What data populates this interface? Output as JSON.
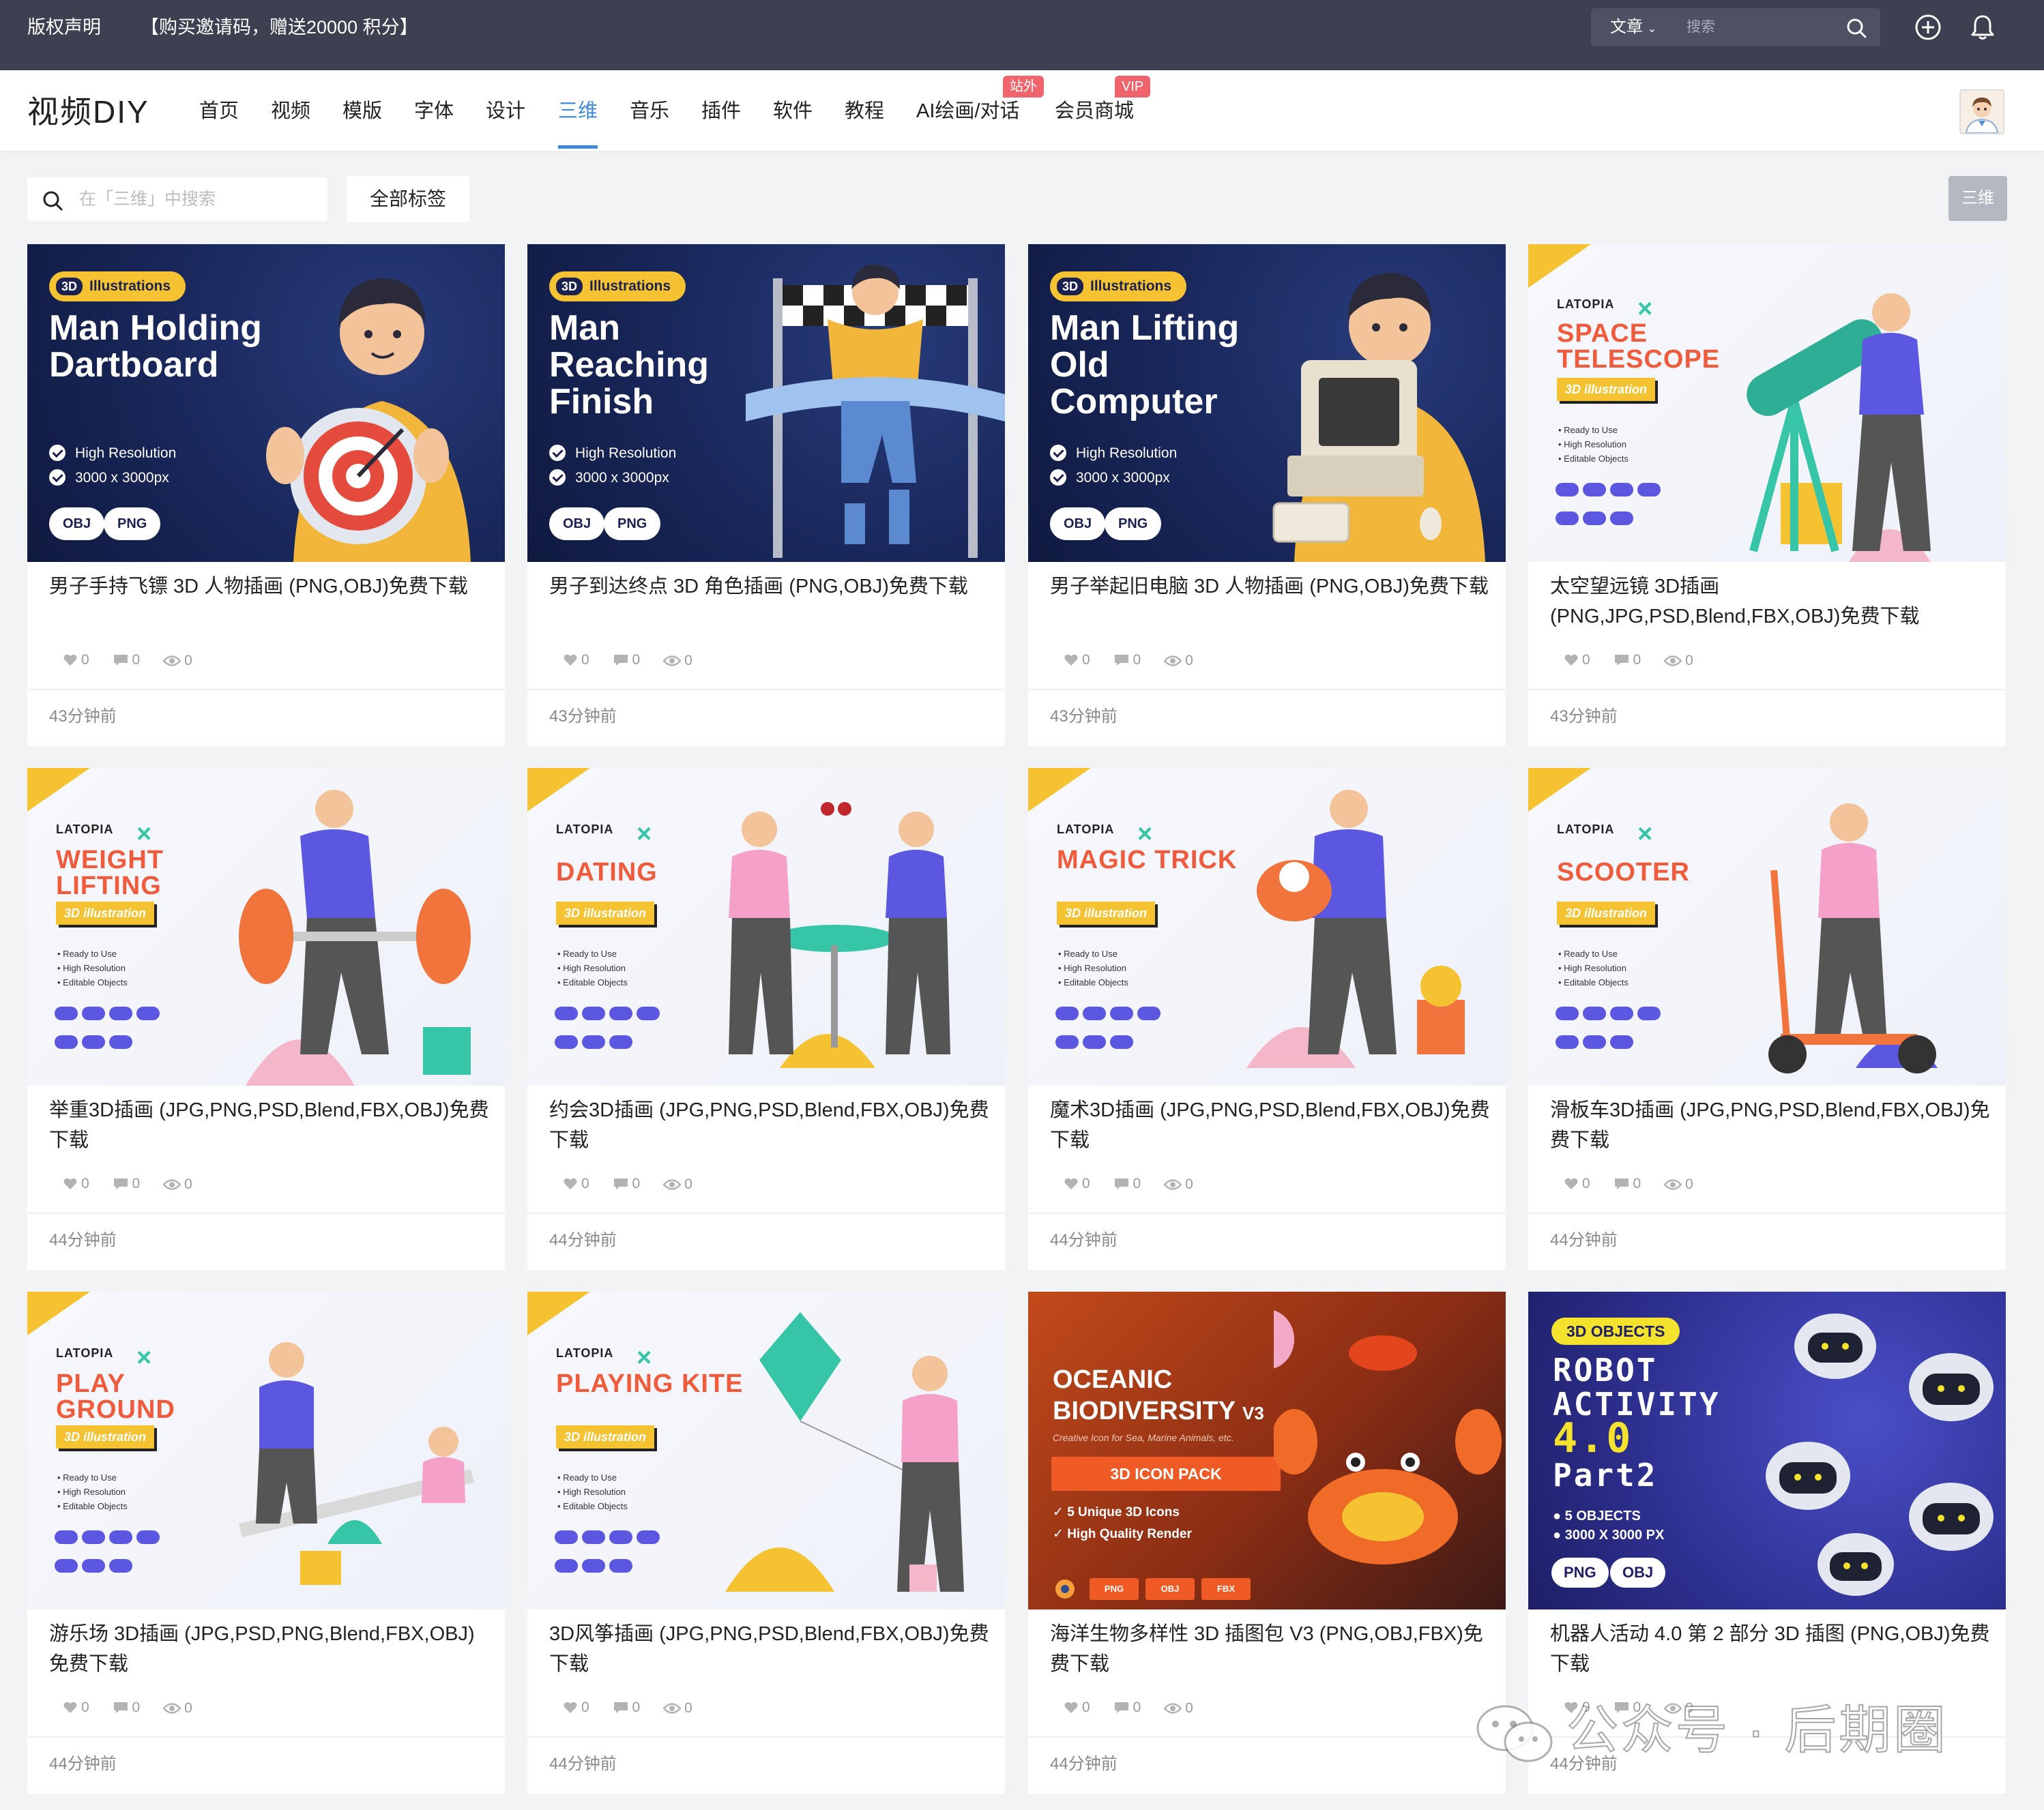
{
  "topbar": {
    "copyright": "版权声明",
    "promo": "【购买邀请码，赠送20000 积分】",
    "search_scope": "文章",
    "search_placeholder": "搜索"
  },
  "nav": {
    "logo": "视频DIY",
    "items": [
      {
        "label": "首页"
      },
      {
        "label": "视频"
      },
      {
        "label": "模版"
      },
      {
        "label": "字体"
      },
      {
        "label": "设计"
      },
      {
        "label": "三维",
        "active": true
      },
      {
        "label": "音乐"
      },
      {
        "label": "插件"
      },
      {
        "label": "软件"
      },
      {
        "label": "教程"
      },
      {
        "label": "AI绘画/对话",
        "badge": "站外"
      },
      {
        "label": "会员商城",
        "badge": "VIP"
      }
    ]
  },
  "filter": {
    "search_placeholder": "在「三维」中搜索",
    "all_tags_label": "全部标签",
    "category_tag": "三维"
  },
  "colors": {
    "topbar": "#3c4050",
    "accent": "#3e8ad8",
    "badge": "#f0646c"
  },
  "cards": [
    {
      "title": "男子手持飞镖 3D 人物插画 (PNG,OBJ)免费下载",
      "likes": "0",
      "comments": "0",
      "views": "0",
      "time": "43分钟前",
      "thumb": {
        "pill": "Illustrations",
        "pill_prefix": "3D",
        "heading": "Man Holding Dartboard",
        "line1": "High Resolution",
        "line2": "3000 x 3000px",
        "fmt1": "OBJ",
        "fmt2": "PNG"
      }
    },
    {
      "title": "男子到达终点 3D 角色插画 (PNG,OBJ)免费下载",
      "likes": "0",
      "comments": "0",
      "views": "0",
      "time": "43分钟前",
      "thumb": {
        "pill": "Illustrations",
        "pill_prefix": "3D",
        "heading": "Man Reaching Finish",
        "line1": "High Resolution",
        "line2": "3000 x 3000px",
        "fmt1": "OBJ",
        "fmt2": "PNG"
      }
    },
    {
      "title": "男子举起旧电脑 3D 人物插画 (PNG,OBJ)免费下载",
      "likes": "0",
      "comments": "0",
      "views": "0",
      "time": "43分钟前",
      "thumb": {
        "pill": "Illustrations",
        "pill_prefix": "3D",
        "heading": "Man Lifting Old Computer",
        "line1": "High Resolution",
        "line2": "3000 x 3000px",
        "fmt1": "OBJ",
        "fmt2": "PNG"
      }
    },
    {
      "title": "太空望远镜 3D插画 (PNG,JPG,PSD,Blend,FBX,OBJ)免费下载",
      "likes": "0",
      "comments": "0",
      "views": "0",
      "time": "43分钟前",
      "thumb": {
        "brand": "LATOPIA",
        "heading": "SPACE TELESCOPE",
        "sub": "3D illustration",
        "b1": "• Ready to Use",
        "b2": "• High Resolution",
        "b3": "• Editable Objects"
      }
    },
    {
      "title": "举重3D插画 (JPG,PNG,PSD,Blend,FBX,OBJ)免费下载",
      "likes": "0",
      "comments": "0",
      "views": "0",
      "time": "44分钟前",
      "thumb": {
        "brand": "LATOPIA",
        "heading": "WEIGHT LIFTING",
        "sub": "3D illustration",
        "b1": "• Ready to Use",
        "b2": "• High Resolution",
        "b3": "• Editable Objects"
      }
    },
    {
      "title": "约会3D插画 (JPG,PNG,PSD,Blend,FBX,OBJ)免费下载",
      "likes": "0",
      "comments": "0",
      "views": "0",
      "time": "44分钟前",
      "thumb": {
        "brand": "LATOPIA",
        "heading": "DATING",
        "sub": "3D illustration",
        "b1": "• Ready to Use",
        "b2": "• High Resolution",
        "b3": "• Editable Objects"
      }
    },
    {
      "title": "魔术3D插画 (JPG,PNG,PSD,Blend,FBX,OBJ)免费下载",
      "likes": "0",
      "comments": "0",
      "views": "0",
      "time": "44分钟前",
      "thumb": {
        "brand": "LATOPIA",
        "heading": "MAGIC TRICK",
        "sub": "3D illustration",
        "b1": "• Ready to Use",
        "b2": "• High Resolution",
        "b3": "• Editable Objects"
      }
    },
    {
      "title": "滑板车3D插画 (JPG,PNG,PSD,Blend,FBX,OBJ)免费下载",
      "likes": "0",
      "comments": "0",
      "views": "0",
      "time": "44分钟前",
      "thumb": {
        "brand": "LATOPIA",
        "heading": "SCOOTER",
        "sub": "3D illustration",
        "b1": "• Ready to Use",
        "b2": "• High Resolution",
        "b3": "• Editable Objects"
      }
    },
    {
      "title": "游乐场 3D插画 (JPG,PSD,PNG,Blend,FBX,OBJ)免费下载",
      "likes": "0",
      "comments": "0",
      "views": "0",
      "time": "44分钟前",
      "thumb": {
        "brand": "LATOPIA",
        "heading": "PLAY GROUND",
        "sub": "3D illustration",
        "b1": "• Ready to Use",
        "b2": "• High Resolution",
        "b3": "• Editable Objects"
      }
    },
    {
      "title": "3D风筝插画 (JPG,PNG,PSD,Blend,FBX,OBJ)免费下载",
      "likes": "0",
      "comments": "0",
      "views": "0",
      "time": "44分钟前",
      "thumb": {
        "brand": "LATOPIA",
        "heading": "PLAYING KITE",
        "sub": "3D illustration",
        "b1": "• Ready to Use",
        "b2": "• High Resolution",
        "b3": "• Editable Objects"
      }
    },
    {
      "title": "海洋生物多样性 3D 插图包 V3 (PNG,OBJ,FBX)免费下载",
      "likes": "0",
      "comments": "0",
      "views": "0",
      "time": "44分钟前",
      "thumb": {
        "heading1": "OCEANIC",
        "heading2": "BIODIVERSITY",
        "version": "V3",
        "sub": "Creative Icon for Sea, Marine Animals, etc.",
        "pack": "3D ICON PACK",
        "line1": "5 Unique 3D Icons",
        "line2": "High Quality Render",
        "fmt1": "PNG",
        "fmt2": "OBJ",
        "fmt3": "FBX"
      }
    },
    {
      "title": "机器人活动 4.0 第 2 部分 3D 插图 (PNG,OBJ)免费下载",
      "likes": "0",
      "comments": "0",
      "views": "0",
      "time": "44分钟前",
      "thumb": {
        "pill": "3D OBJECTS",
        "heading": "ROBOT ACTIVITY",
        "version": "4.0",
        "part": "Part2",
        "line1": "5 OBJECTS",
        "line2": "3000 X 3000 PX",
        "fmt1": "PNG",
        "fmt2": "OBJ"
      }
    }
  ],
  "watermark": "公众号 · 后期圈"
}
